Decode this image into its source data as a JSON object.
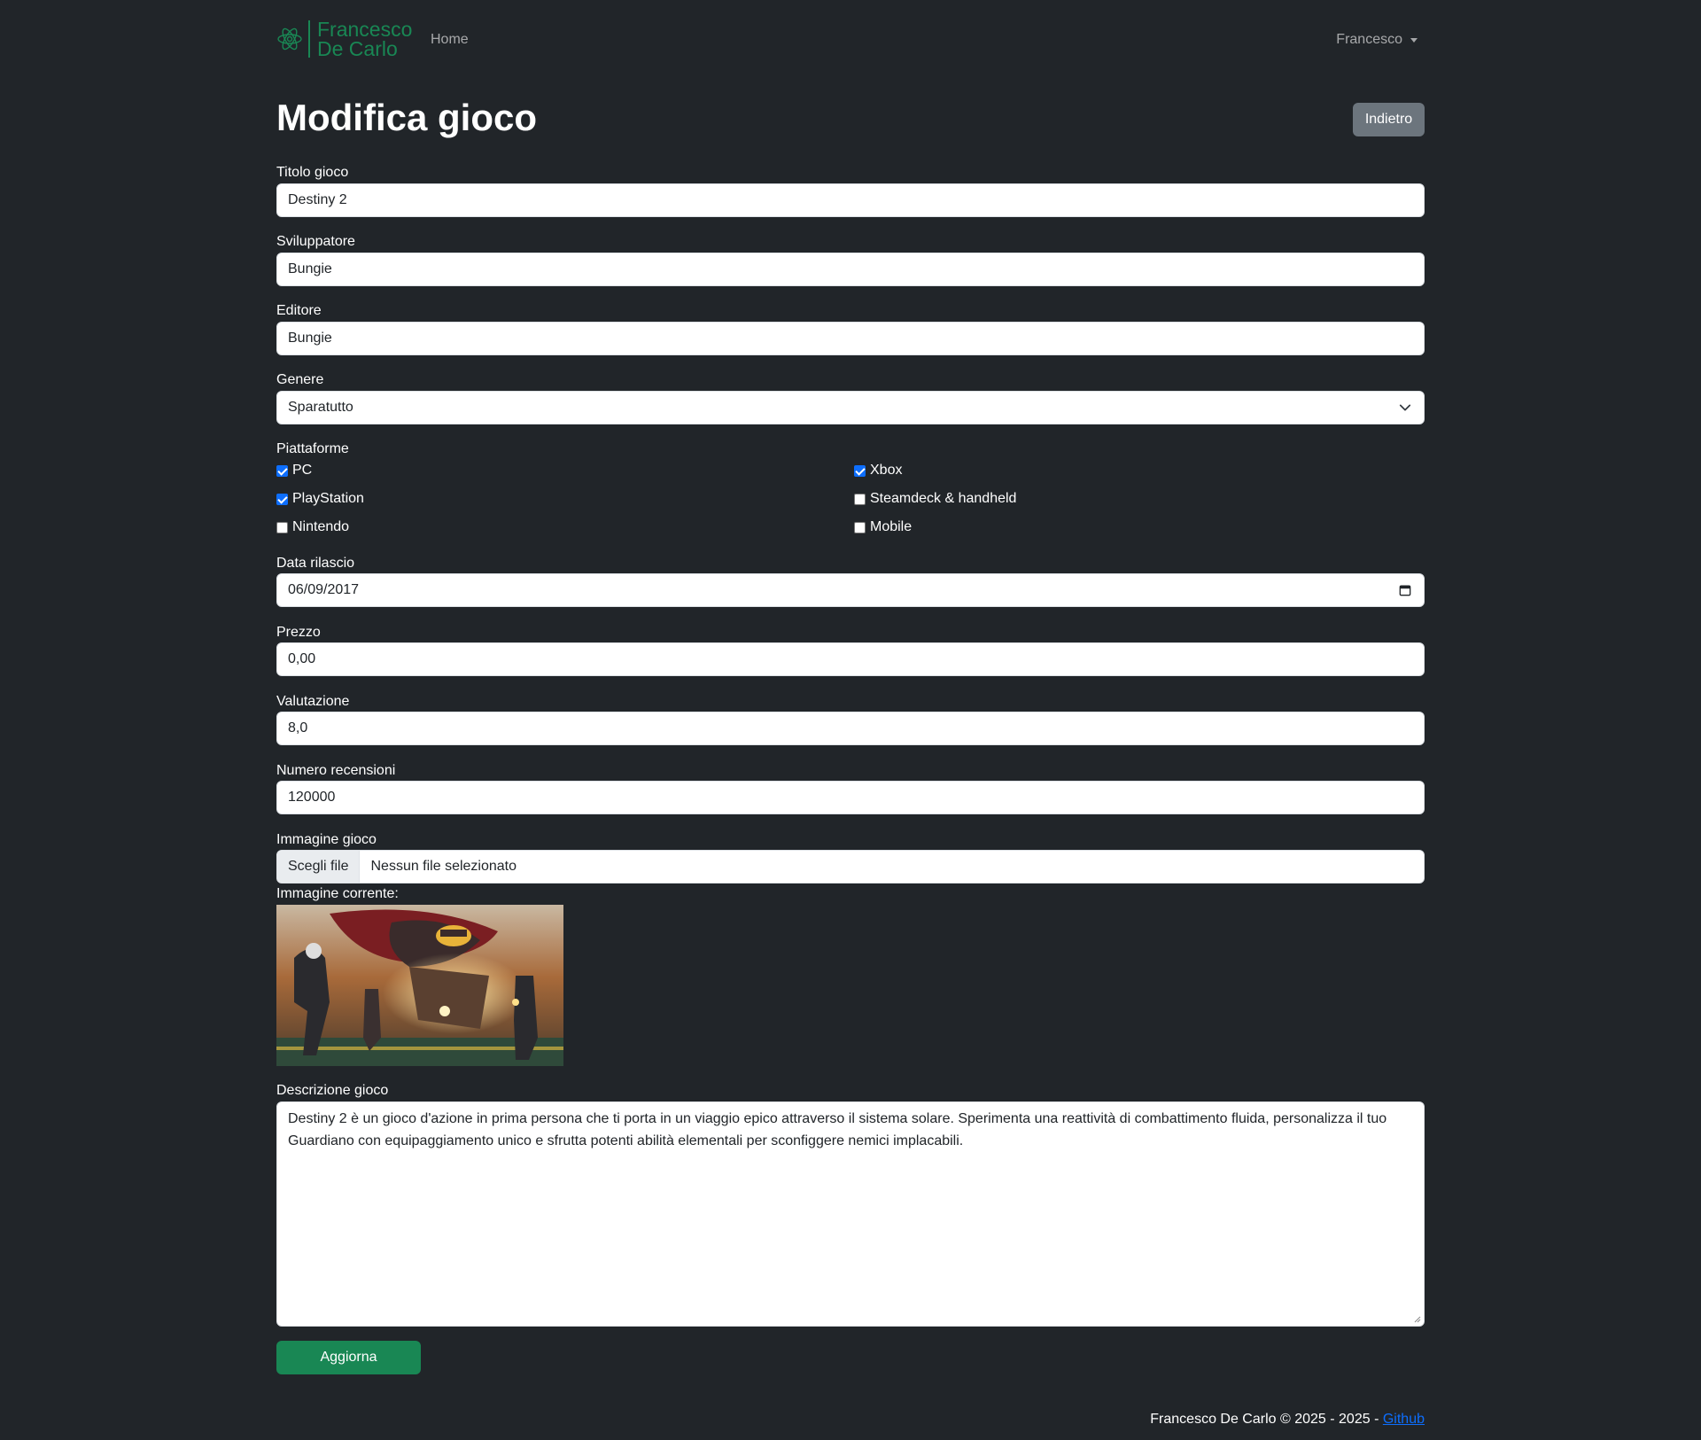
{
  "navbar": {
    "brand_line1": "Francesco",
    "brand_line2": "De Carlo",
    "home": "Home",
    "user": "Francesco"
  },
  "header": {
    "title": "Modifica gioco",
    "back": "Indietro"
  },
  "form": {
    "title_label": "Titolo gioco",
    "title_value": "Destiny 2",
    "developer_label": "Sviluppatore",
    "developer_value": "Bungie",
    "publisher_label": "Editore",
    "publisher_value": "Bungie",
    "genre_label": "Genere",
    "genre_value": "Sparatutto",
    "platforms_label": "Piattaforme",
    "platforms": [
      {
        "label": "PC",
        "checked": true
      },
      {
        "label": "Xbox",
        "checked": true
      },
      {
        "label": "PlayStation",
        "checked": true
      },
      {
        "label": "Steamdeck & handheld",
        "checked": false
      },
      {
        "label": "Nintendo",
        "checked": false
      },
      {
        "label": "Mobile",
        "checked": false
      }
    ],
    "release_label": "Data rilascio",
    "release_value": "06/09/2017",
    "price_label": "Prezzo",
    "price_value": "0,00",
    "rating_label": "Valutazione",
    "rating_value": "8,0",
    "reviews_label": "Numero recensioni",
    "reviews_value": "120000",
    "image_label": "Immagine gioco",
    "file_button": "Scegli file",
    "file_status": "Nessun file selezionato",
    "current_image_label": "Immagine corrente:",
    "description_label": "Descrizione gioco",
    "description_value": "Destiny 2 è un gioco d'azione in prima persona che ti porta in un viaggio epico attraverso il sistema solare. Sperimenta una reattività di combattimento fluida, personalizza il tuo Guardiano con equipaggiamento unico e sfrutta potenti abilità elementali per sconfiggere nemici implacabili.",
    "submit": "Aggiorna"
  },
  "footer": {
    "text": "Francesco De Carlo © 2025 - 2025 -",
    "link": "Github"
  },
  "colors": {
    "background": "#212529",
    "brand": "#198754",
    "secondary_button": "#6c757d",
    "checkbox_checked": "#0d6efd",
    "link": "#0d6efd"
  }
}
